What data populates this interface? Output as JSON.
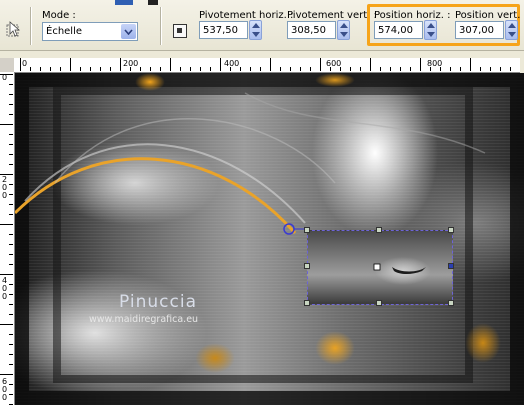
{
  "toolbar": {
    "mode_label": "Mode :",
    "mode_value": "Échelle",
    "pivot_h_label": "Pivotement horiz. :",
    "pivot_h_value": "537,50",
    "pivot_v_label": "Pivotement vert. :",
    "pivot_v_value": "308,50",
    "pos_h_label": "Position horiz. :",
    "pos_h_value": "574,00",
    "pos_v_label": "Position vert. :",
    "pos_v_value": "307,00",
    "highlight_color": "#f6a41a"
  },
  "ruler_h": {
    "labels": [
      "0",
      "200",
      "400",
      "600",
      "800"
    ]
  },
  "ruler_v": {
    "labels": [
      "0",
      "2\n0\n0",
      "4\n0\n0",
      "6\n0\n0"
    ]
  },
  "watermark": {
    "name": "Pinuccia",
    "url": "www.maidiregrafica.eu"
  },
  "icons": {
    "tool": "pick-tool-icon",
    "dropdown": "chevron-down-icon",
    "pivot": "pivot-point-icon",
    "spin": "spinner-icon"
  }
}
